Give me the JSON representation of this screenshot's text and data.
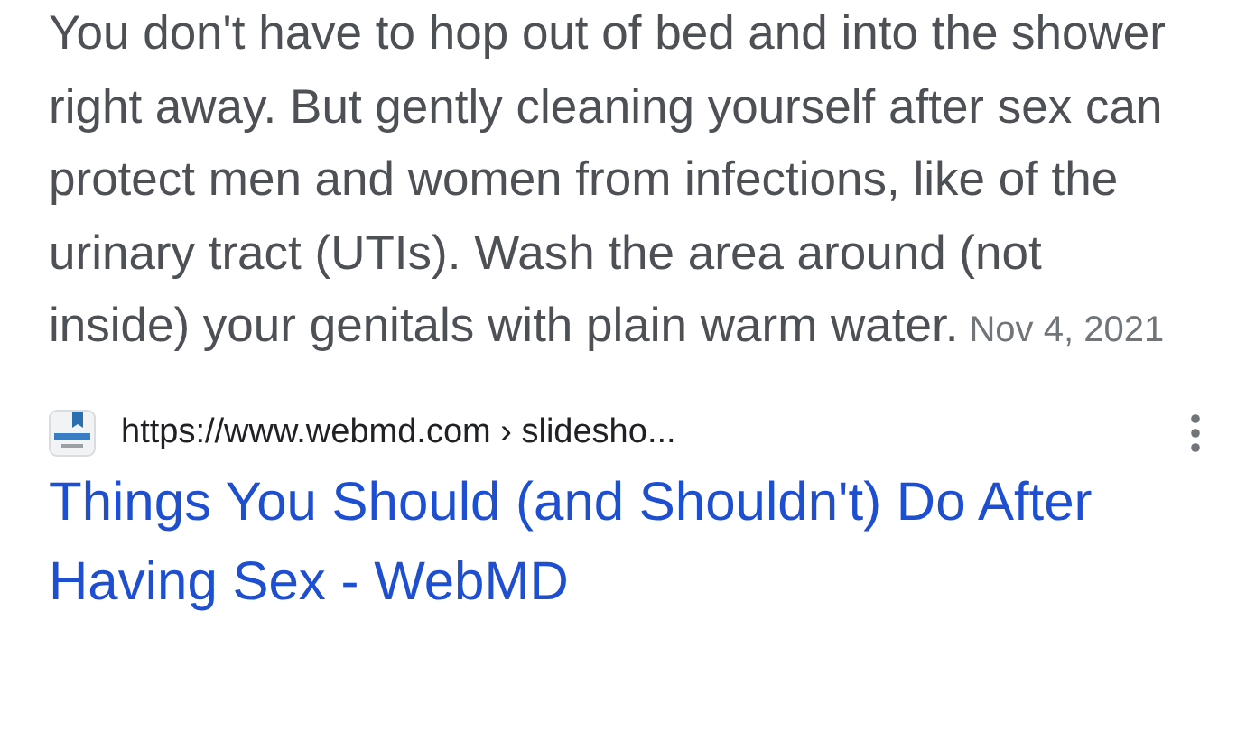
{
  "snippet": {
    "text": "You don't have to hop out of bed and into the shower right away. But gently cleaning yourself after sex can protect men and women from infections, like of the urinary tract (UTIs). Wash the area around (not inside) your genitals with plain warm water.",
    "date": "Nov 4, 2021"
  },
  "result": {
    "url": "https://www.webmd.com › slidesho...",
    "title": "Things You Should (and Shouldn't) Do After Having Sex - WebMD"
  }
}
